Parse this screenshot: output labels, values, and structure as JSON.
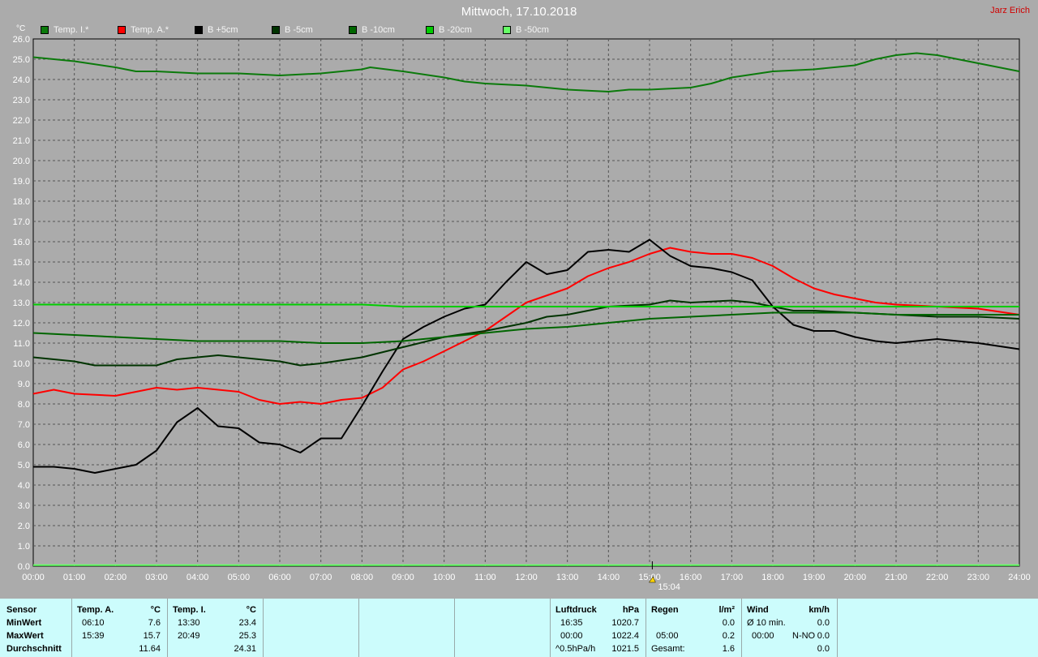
{
  "header": {
    "title": "Mittwoch, 17.10.2018",
    "author": "Jarz Erich"
  },
  "legend": [
    {
      "label": "Temp. I.*",
      "color": "#0b7a0b"
    },
    {
      "label": "Temp. A.*",
      "color": "#ff0000"
    },
    {
      "label": "B +5cm",
      "color": "#000000"
    },
    {
      "label": "B -5cm",
      "color": "#003300"
    },
    {
      "label": "B -10cm",
      "color": "#006600"
    },
    {
      "label": "B -20cm",
      "color": "#00cc00"
    },
    {
      "label": "B -50cm",
      "color": "#66ff66"
    }
  ],
  "marker": {
    "label": "15:04"
  },
  "chart_data": {
    "type": "line",
    "ylabel": "°C",
    "ylim": [
      0,
      26
    ],
    "yticks": [
      "0.0",
      "1.0",
      "2.0",
      "3.0",
      "4.0",
      "5.0",
      "6.0",
      "7.0",
      "8.0",
      "9.0",
      "10.0",
      "11.0",
      "12.0",
      "13.0",
      "14.0",
      "15.0",
      "16.0",
      "17.0",
      "18.0",
      "19.0",
      "20.0",
      "21.0",
      "22.0",
      "23.0",
      "24.0",
      "25.0",
      "26.0"
    ],
    "xlabel": "",
    "xlim": [
      0,
      24
    ],
    "xticks": [
      "00:00",
      "01:00",
      "02:00",
      "03:00",
      "04:00",
      "05:00",
      "06:00",
      "07:00",
      "08:00",
      "09:00",
      "10:00",
      "11:00",
      "12:00",
      "13:00",
      "14:00",
      "15:00",
      "16:00",
      "17:00",
      "18:00",
      "19:00",
      "20:00",
      "21:00",
      "22:00",
      "23:00",
      "24:00"
    ],
    "grid": true,
    "series": [
      {
        "name": "Temp. I.*",
        "color": "#0b7a0b",
        "x": [
          0,
          1,
          2,
          2.5,
          3,
          4,
          5,
          6,
          7,
          8,
          8.2,
          9,
          10,
          10.5,
          11,
          12,
          13,
          14,
          14.5,
          15,
          16,
          16.5,
          17,
          18,
          19,
          20,
          20.5,
          21,
          21.5,
          22,
          23,
          24
        ],
        "y": [
          25.1,
          24.9,
          24.6,
          24.4,
          24.4,
          24.3,
          24.3,
          24.2,
          24.3,
          24.5,
          24.6,
          24.4,
          24.1,
          23.9,
          23.8,
          23.7,
          23.5,
          23.4,
          23.5,
          23.5,
          23.6,
          23.8,
          24.1,
          24.4,
          24.5,
          24.7,
          25.0,
          25.2,
          25.3,
          25.2,
          24.8,
          24.4
        ]
      },
      {
        "name": "Temp. A.*",
        "color": "#ff0000",
        "x": [
          0,
          0.5,
          1,
          2,
          2.5,
          3,
          3.5,
          4,
          5,
          5.5,
          6,
          6.5,
          7,
          7.5,
          8,
          8.5,
          9,
          9.5,
          10,
          10.5,
          11,
          11.5,
          12,
          13,
          13.5,
          14,
          14.5,
          15,
          15.5,
          16,
          16.5,
          17,
          17.5,
          18,
          18.5,
          19,
          19.5,
          20,
          20.5,
          21,
          22,
          23,
          24
        ],
        "y": [
          8.5,
          8.7,
          8.5,
          8.4,
          8.6,
          8.8,
          8.7,
          8.8,
          8.6,
          8.2,
          8.0,
          8.1,
          8.0,
          8.2,
          8.3,
          8.8,
          9.7,
          10.1,
          10.6,
          11.1,
          11.6,
          12.3,
          13.0,
          13.7,
          14.3,
          14.7,
          15.0,
          15.4,
          15.7,
          15.5,
          15.4,
          15.4,
          15.2,
          14.8,
          14.2,
          13.7,
          13.4,
          13.2,
          13.0,
          12.9,
          12.8,
          12.7,
          12.4
        ]
      },
      {
        "name": "B +5cm",
        "color": "#000000",
        "x": [
          0,
          0.5,
          1,
          1.5,
          2,
          2.5,
          3,
          3.5,
          4,
          4.5,
          5,
          5.5,
          6,
          6.5,
          7,
          7.5,
          8,
          8.5,
          9,
          9.5,
          10,
          10.5,
          11,
          11.5,
          12,
          12.5,
          13,
          13.5,
          14,
          14.5,
          15,
          15.5,
          16,
          16.5,
          17,
          17.5,
          18,
          18.5,
          19,
          19.5,
          20,
          20.5,
          21,
          22,
          23,
          24
        ],
        "y": [
          4.9,
          4.9,
          4.8,
          4.6,
          4.8,
          5.0,
          5.7,
          7.1,
          7.8,
          6.9,
          6.8,
          6.1,
          6.0,
          5.6,
          6.3,
          6.3,
          7.9,
          9.6,
          11.2,
          11.8,
          12.3,
          12.7,
          12.9,
          14.0,
          15.0,
          14.4,
          14.6,
          15.5,
          15.6,
          15.5,
          16.1,
          15.3,
          14.8,
          14.7,
          14.5,
          14.1,
          12.8,
          11.9,
          11.6,
          11.6,
          11.3,
          11.1,
          11.0,
          11.2,
          11.0,
          10.7
        ]
      },
      {
        "name": "B -5cm",
        "color": "#003300",
        "x": [
          0,
          1,
          1.5,
          2,
          3,
          3.5,
          4,
          4.5,
          5,
          6,
          6.5,
          7,
          8,
          9,
          10,
          11,
          12,
          12.5,
          13,
          13.5,
          14,
          15,
          15.5,
          16,
          17,
          17.5,
          18,
          18.5,
          19,
          20,
          21,
          22,
          23,
          24
        ],
        "y": [
          10.3,
          10.1,
          9.9,
          9.9,
          9.9,
          10.2,
          10.3,
          10.4,
          10.3,
          10.1,
          9.9,
          10.0,
          10.3,
          10.8,
          11.3,
          11.6,
          12.0,
          12.3,
          12.4,
          12.6,
          12.8,
          12.9,
          13.1,
          13.0,
          13.1,
          13.0,
          12.8,
          12.6,
          12.6,
          12.5,
          12.4,
          12.3,
          12.3,
          12.2
        ]
      },
      {
        "name": "B -10cm",
        "color": "#006600",
        "x": [
          0,
          1,
          2,
          3,
          4,
          5,
          6,
          7,
          8,
          9,
          10,
          11,
          12,
          13,
          14,
          15,
          16,
          17,
          18,
          19,
          20,
          21,
          22,
          23,
          24
        ],
        "y": [
          11.5,
          11.4,
          11.3,
          11.2,
          11.1,
          11.1,
          11.1,
          11.0,
          11.0,
          11.1,
          11.3,
          11.5,
          11.7,
          11.8,
          12.0,
          12.2,
          12.3,
          12.4,
          12.5,
          12.5,
          12.5,
          12.4,
          12.4,
          12.4,
          12.4
        ]
      },
      {
        "name": "B -20cm",
        "color": "#00cc00",
        "x": [
          0,
          2,
          4,
          6,
          8,
          9,
          12,
          14,
          16,
          18,
          20,
          22,
          24
        ],
        "y": [
          12.9,
          12.9,
          12.9,
          12.9,
          12.9,
          12.8,
          12.8,
          12.8,
          12.8,
          12.8,
          12.8,
          12.8,
          12.8
        ]
      },
      {
        "name": "B -50cm",
        "color": "#66ff66",
        "x": [
          0,
          24
        ],
        "y": [
          0.05,
          0.05
        ]
      }
    ]
  },
  "table": {
    "sensor_header": "Sensor",
    "row_labels": [
      "MinWert",
      "MaxWert",
      "Durchschnitt"
    ],
    "temp_a": {
      "header": "Temp. A.",
      "unit": "°C",
      "min_time": "06:10",
      "min_val": "7.6",
      "max_time": "15:39",
      "max_val": "15.7",
      "avg": "11.64"
    },
    "temp_i": {
      "header": "Temp. I.",
      "unit": "°C",
      "min_time": "13:30",
      "min_val": "23.4",
      "max_time": "20:49",
      "max_val": "25.3",
      "avg": "24.31"
    },
    "pressure": {
      "header": "Luftdruck",
      "unit": "hPa",
      "min_time": "16:35",
      "min_val": "1020.7",
      "max_time": "00:00",
      "max_val": "1022.4",
      "avg_label": "^0.5hPa/h",
      "avg": "1021.5"
    },
    "rain": {
      "header": "Regen",
      "unit": "l/m²",
      "min_val": "0.0",
      "max_time": "05:00",
      "max_val": "0.2",
      "total_label": "Gesamt:",
      "total": "1.6"
    },
    "wind": {
      "header": "Wind",
      "unit": "km/h",
      "min_label": "Ø 10 min.",
      "min_val": "0.0",
      "max_time": "00:00",
      "max_dir": "N-NO",
      "max_val": "0.0",
      "avg": "0.0"
    }
  }
}
